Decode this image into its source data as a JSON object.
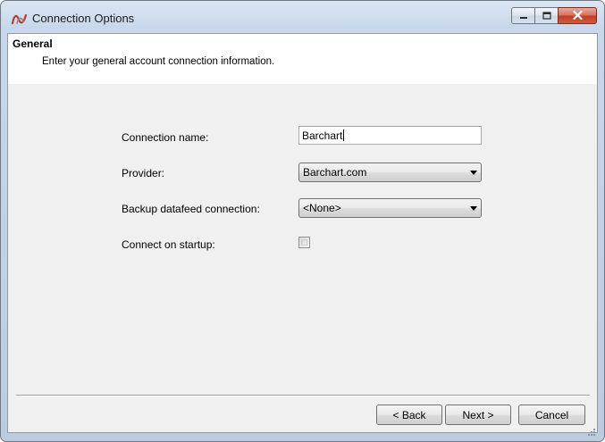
{
  "window": {
    "title": "Connection Options",
    "app_icon": "nt-logo-icon",
    "controls": [
      "minimize-icon",
      "maximize-icon",
      "close-icon"
    ]
  },
  "header": {
    "title": "General",
    "subtitle": "Enter your general account connection information."
  },
  "form": {
    "connection_name": {
      "label": "Connection name:",
      "value": "Barchart"
    },
    "provider": {
      "label": "Provider:",
      "value": "Barchart.com"
    },
    "backup": {
      "label": "Backup datafeed connection:",
      "value": "<None>"
    },
    "startup": {
      "label": "Connect on startup:",
      "checked": false
    }
  },
  "buttons": {
    "back": "< Back",
    "next": "Next >",
    "cancel": "Cancel"
  },
  "colors": {
    "title_gradient_top": "#dbe6f3",
    "close_button": "#c23b21",
    "client_bg": "#f0f0f0",
    "header_bg": "#ffffff"
  }
}
